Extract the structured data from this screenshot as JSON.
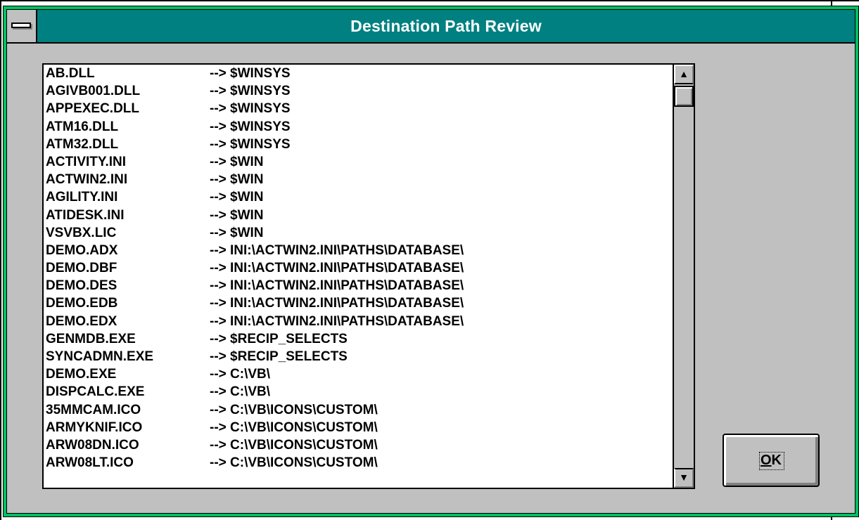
{
  "window": {
    "title": "Destination Path Review"
  },
  "list": {
    "rows": [
      {
        "file": "AB.DLL",
        "dest": "--> $WINSYS"
      },
      {
        "file": "AGIVB001.DLL",
        "dest": "--> $WINSYS"
      },
      {
        "file": "APPEXEC.DLL",
        "dest": "--> $WINSYS"
      },
      {
        "file": "ATM16.DLL",
        "dest": "--> $WINSYS"
      },
      {
        "file": "ATM32.DLL",
        "dest": "--> $WINSYS"
      },
      {
        "file": "ACTIVITY.INI",
        "dest": "--> $WIN"
      },
      {
        "file": "ACTWIN2.INI",
        "dest": "--> $WIN"
      },
      {
        "file": "AGILITY.INI",
        "dest": "--> $WIN"
      },
      {
        "file": "ATIDESK.INI",
        "dest": "--> $WIN"
      },
      {
        "file": "VSVBX.LIC",
        "dest": "--> $WIN"
      },
      {
        "file": "DEMO.ADX",
        "dest": "--> INI:\\ACTWIN2.INI\\PATHS\\DATABASE\\"
      },
      {
        "file": "DEMO.DBF",
        "dest": "--> INI:\\ACTWIN2.INI\\PATHS\\DATABASE\\"
      },
      {
        "file": "DEMO.DES",
        "dest": "--> INI:\\ACTWIN2.INI\\PATHS\\DATABASE\\"
      },
      {
        "file": "DEMO.EDB",
        "dest": "--> INI:\\ACTWIN2.INI\\PATHS\\DATABASE\\"
      },
      {
        "file": "DEMO.EDX",
        "dest": "--> INI:\\ACTWIN2.INI\\PATHS\\DATABASE\\"
      },
      {
        "file": "GENMDB.EXE",
        "dest": "--> $RECIP_SELECTS"
      },
      {
        "file": "SYNCADMN.EXE",
        "dest": "--> $RECIP_SELECTS"
      },
      {
        "file": "DEMO.EXE",
        "dest": "--> C:\\VB\\"
      },
      {
        "file": "DISPCALC.EXE",
        "dest": "--> C:\\VB\\"
      },
      {
        "file": "35MMCAM.ICO",
        "dest": "--> C:\\VB\\ICONS\\CUSTOM\\"
      },
      {
        "file": "ARMYKNIF.ICO",
        "dest": "--> C:\\VB\\ICONS\\CUSTOM\\"
      },
      {
        "file": "ARW08DN.ICO",
        "dest": "--> C:\\VB\\ICONS\\CUSTOM\\"
      },
      {
        "file": "ARW08LT.ICO",
        "dest": "--> C:\\VB\\ICONS\\CUSTOM\\"
      }
    ]
  },
  "buttons": {
    "ok_accel": "O",
    "ok_rest": "K"
  },
  "icons": {
    "system_menu": "system-menu-icon",
    "scroll_up": "arrow-up-icon",
    "scroll_down": "arrow-down-icon"
  }
}
